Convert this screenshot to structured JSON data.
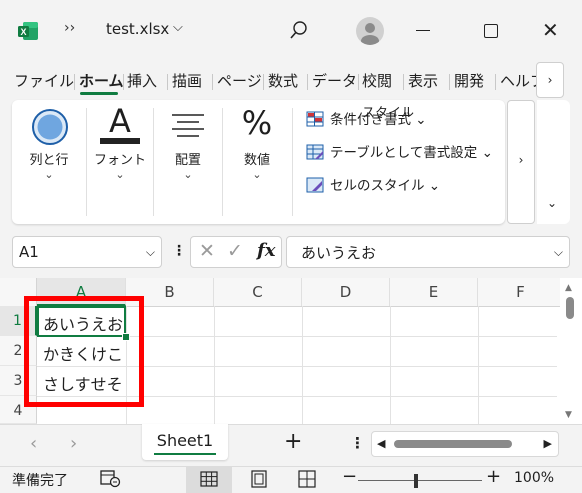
{
  "titlebar": {
    "app_icon_label": "X",
    "more_glyph": "››",
    "file_title": "test.xlsx",
    "dropdown_glyph": "⌵"
  },
  "tabs": [
    {
      "label": "ファイル"
    },
    {
      "label": "ホーム"
    },
    {
      "label": "挿入"
    },
    {
      "label": "描画"
    },
    {
      "label": "ページ"
    },
    {
      "label": "数式"
    },
    {
      "label": "データ"
    },
    {
      "label": "校閲"
    },
    {
      "label": "表示"
    },
    {
      "label": "開発"
    },
    {
      "label": "ヘルプ"
    }
  ],
  "tab_scroll_glyph": "›",
  "ribbon": {
    "groups": [
      {
        "label": "列と行",
        "chevron": "⌄"
      },
      {
        "label": "フォント",
        "chevron": "⌄"
      },
      {
        "label": "配置",
        "chevron": "⌄"
      },
      {
        "label": "数値",
        "chevron": "⌄"
      }
    ],
    "percent_glyph": "%",
    "font_glyph": "A",
    "style_items": [
      {
        "label": "条件付き書式 ⌄"
      },
      {
        "label": "テーブルとして書式設定 ⌄"
      },
      {
        "label": "セルのスタイル ⌄"
      }
    ],
    "style_group_label": "スタイル",
    "more_glyph": "›",
    "collapse_glyph": "⌄"
  },
  "formula_bar": {
    "name_box": "A1",
    "dropdown_glyph": "⌵",
    "dots": "⋮",
    "cancel_glyph": "✕",
    "enter_glyph": "✓",
    "fx_label": "fx",
    "formula_value": "あいうえお"
  },
  "grid": {
    "columns": [
      "A",
      "B",
      "C",
      "D",
      "E",
      "F"
    ],
    "rows": [
      "1",
      "2",
      "3",
      "4"
    ],
    "cells": [
      "あいうえお",
      "かきくけこ",
      "さしすせそ"
    ]
  },
  "sheetbar": {
    "prev_glyph": "‹",
    "next_glyph": "›",
    "sheet_name": "Sheet1",
    "add_glyph": "+",
    "menu_glyph": "⋮"
  },
  "statusbar": {
    "status": "準備完了",
    "zoom_minus": "−",
    "zoom_plus": "+",
    "zoom": "100%",
    "zoom_fraction": 0.47
  },
  "colors": {
    "accent": "#107c41",
    "highlight": "#ff0000"
  }
}
